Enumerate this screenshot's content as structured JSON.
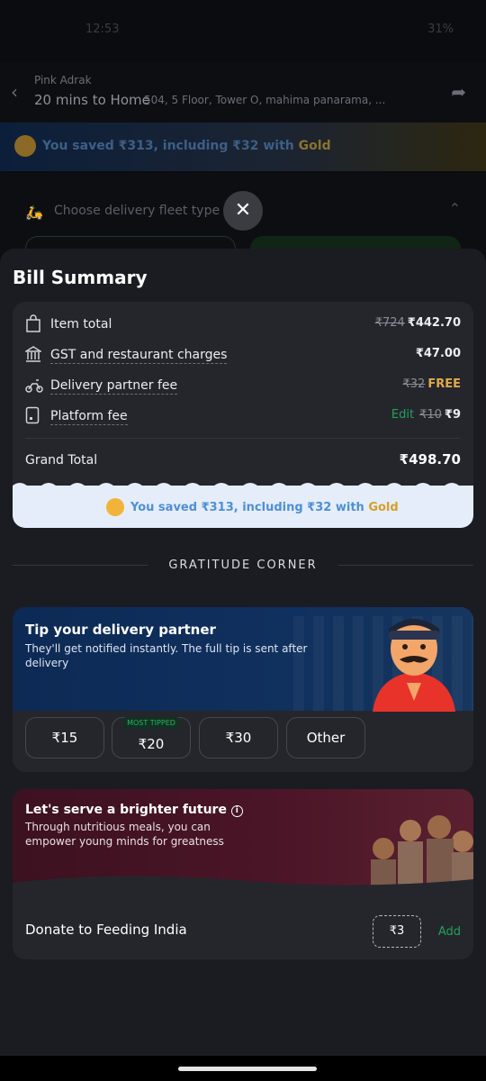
{
  "status_bar": {
    "time": "12:53",
    "battery": "31%"
  },
  "header": {
    "store_name": "Pink Adrak",
    "eta": "20 mins to Home",
    "address": "504, 5 Floor, Tower O, mahima panarama, ..."
  },
  "gold_banner": {
    "text": "You saved ₹313, including ₹32 with ",
    "gold_word": "Gold"
  },
  "fleet": {
    "label": "Choose delivery fleet type"
  },
  "bill_summary": {
    "title": "Bill Summary",
    "rows": [
      {
        "label": "Item total",
        "original": "₹724",
        "value": "₹442.70"
      },
      {
        "label": "GST and restaurant charges",
        "value": "₹47.00"
      },
      {
        "label": "Delivery partner fee",
        "original": "₹32",
        "value": "FREE"
      },
      {
        "label": "Platform fee",
        "edit": "Edit",
        "original": "₹10",
        "value": "₹9"
      }
    ],
    "grand_total_label": "Grand Total",
    "grand_total_value": "₹498.70",
    "saved_text": "You saved ₹313, including ₹32 with ",
    "saved_gold": "Gold"
  },
  "gratitude": {
    "title": "GRATITUDE CORNER"
  },
  "tip": {
    "title": "Tip your delivery partner",
    "subtitle": "They'll get notified instantly. The full tip is sent after delivery",
    "options": [
      "₹15",
      "₹20",
      "₹30",
      "Other"
    ],
    "most_tipped_label": "MOST TIPPED"
  },
  "donate": {
    "title": "Let's serve a brighter future",
    "subtitle": "Through nutritious meals, you can empower young minds for greatness",
    "label": "Donate to Feeding India",
    "amount": "₹3",
    "add_label": "Add"
  },
  "colors": {
    "accent_green": "#23a15a",
    "gold": "#d4a02b",
    "free_orange": "#e0a94c"
  }
}
